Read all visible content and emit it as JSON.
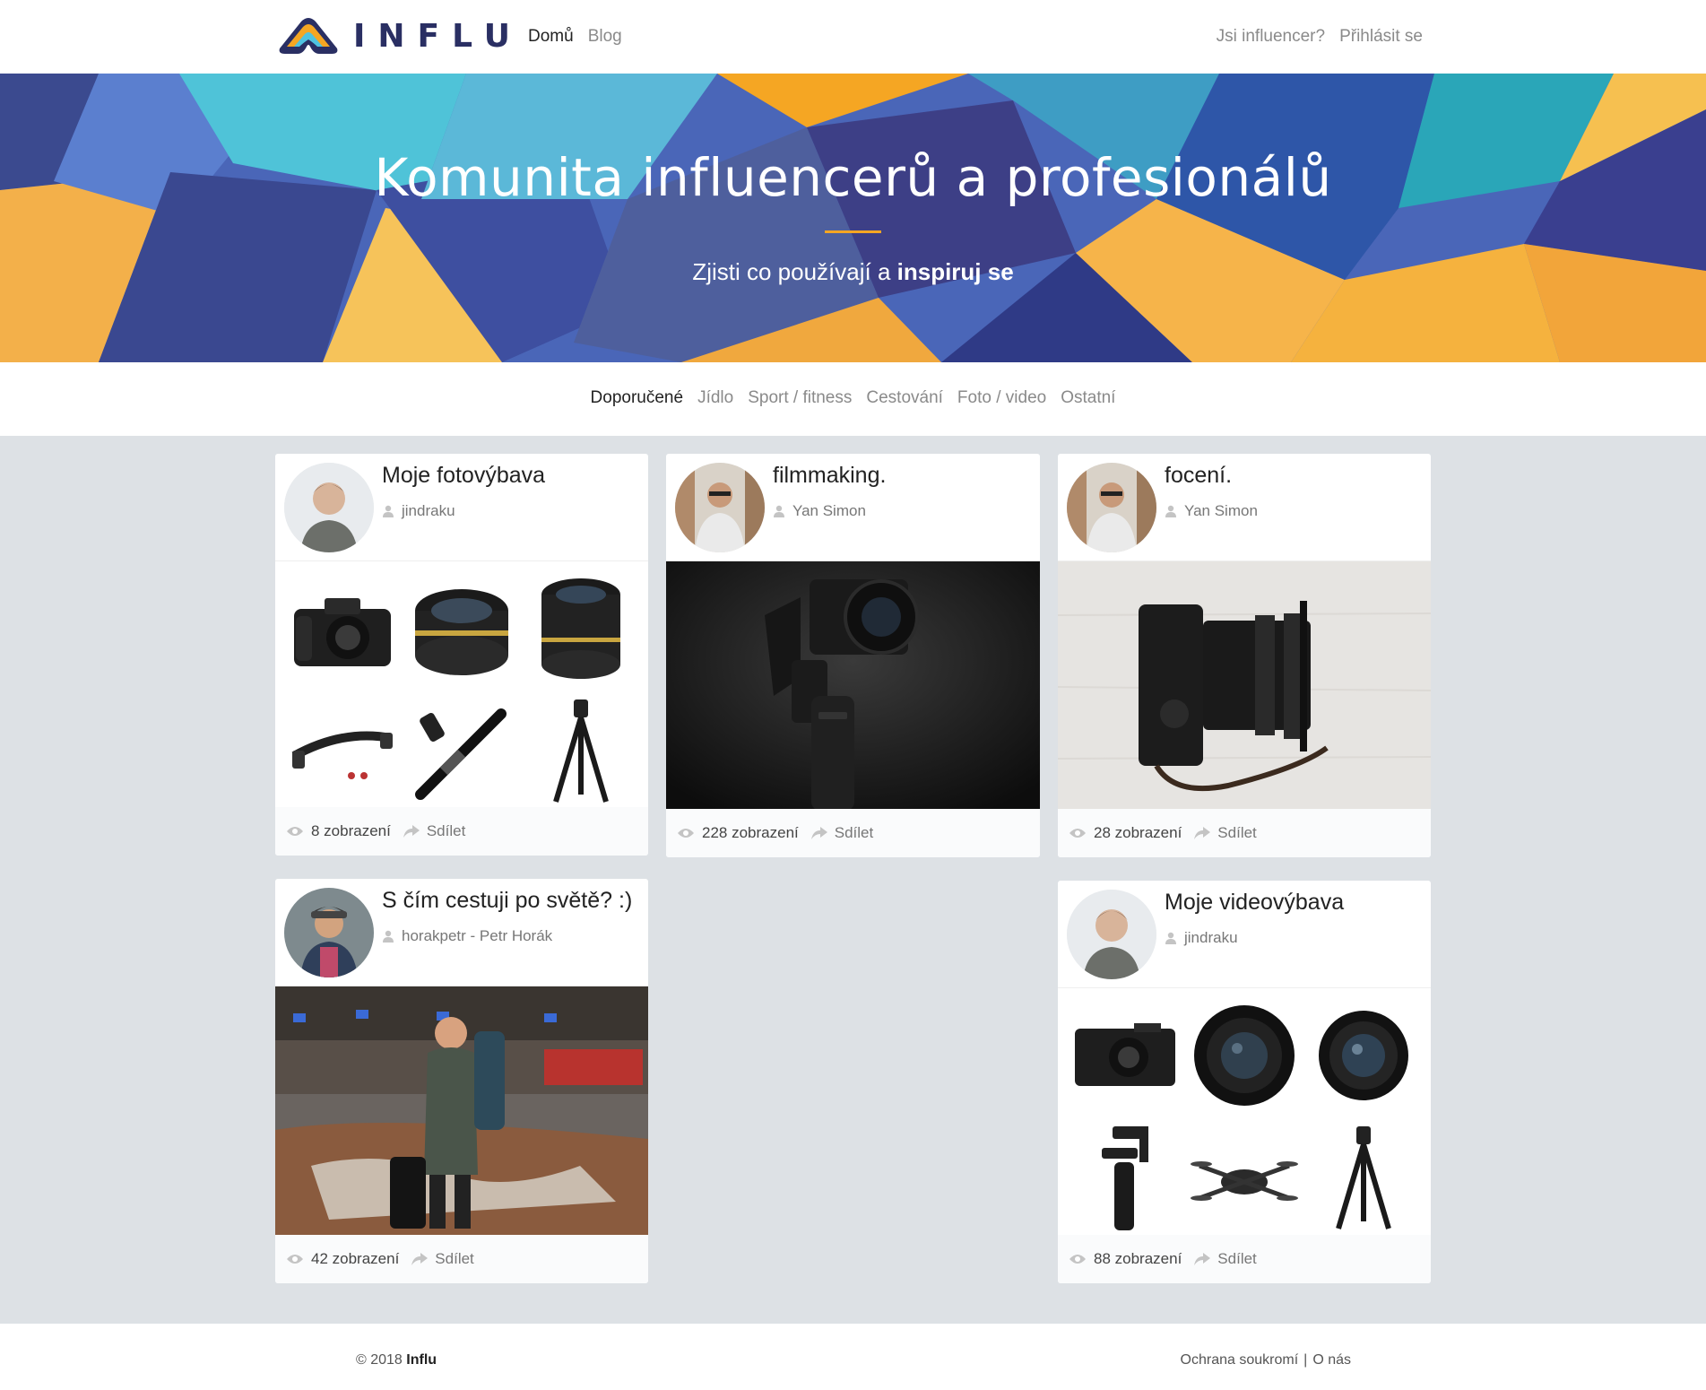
{
  "brand": {
    "name": "INFLU",
    "accent": "#f5a623",
    "navy": "#2a2f63"
  },
  "nav": {
    "home": "Domů",
    "blog": "Blog",
    "influencer": "Jsi influencer?",
    "login": "Přihlásit se"
  },
  "hero": {
    "title": "Komunita influencerů a profesionálů",
    "sub_prefix": "Zjisti co používají a",
    "sub_bold": "inspiruj se"
  },
  "categories": [
    "Doporučené",
    "Jídlo",
    "Sport / fitness",
    "Cestování",
    "Foto / video",
    "Ostatní"
  ],
  "cards": [
    {
      "title": "Moje fotovýbava",
      "author": "jindraku",
      "views": "8 zobrazení",
      "share": "Sdílet",
      "avatar": "man-portrait-icon",
      "media": "camera-gear-grid"
    },
    {
      "title": "filmmaking.",
      "author": "Yan Simon",
      "views": "228 zobrazení",
      "share": "Sdílet",
      "avatar": "man-street-icon",
      "media": "gimbal-photo"
    },
    {
      "title": "focení.",
      "author": "Yan Simon",
      "views": "28 zobrazení",
      "share": "Sdílet",
      "avatar": "man-street-icon",
      "media": "camera-on-wood-photo"
    },
    {
      "title": "S čím cestuji po světě? :)",
      "author": "horakpetr - Petr Horák",
      "views": "42 zobrazení",
      "share": "Sdílet",
      "avatar": "man-cap-icon",
      "media": "airport-photo"
    },
    {
      "title": "Moje videovýbava",
      "author": "jindraku",
      "views": "88 zobrazení",
      "share": "Sdílet",
      "avatar": "man-portrait-icon",
      "media": "video-gear-grid"
    }
  ],
  "footer": {
    "copy_prefix": "© 2018",
    "copy_brand": "Influ",
    "privacy": "Ochrana soukromí",
    "sep": "|",
    "about": "O nás"
  }
}
